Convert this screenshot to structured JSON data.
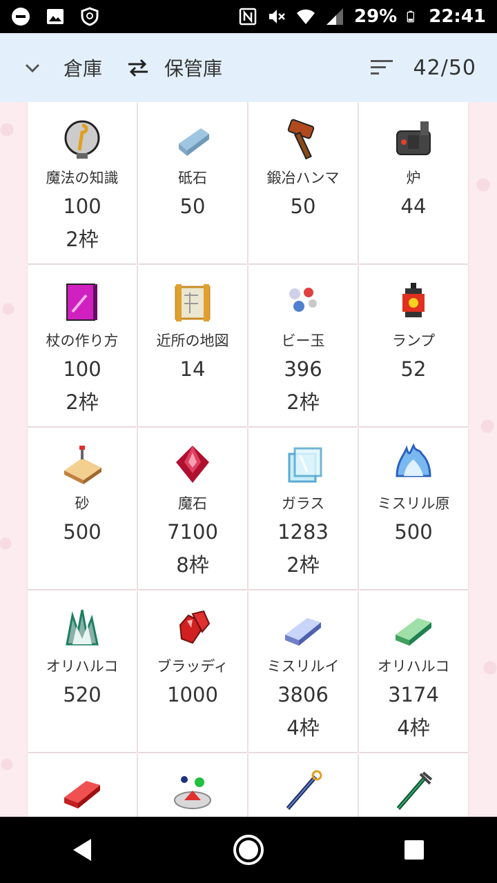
{
  "status_bar": {
    "battery": "29%",
    "time": "22:41",
    "left_icons": [
      "dnd-icon",
      "image-icon",
      "shield-icon"
    ],
    "right_icons": [
      "nfc-icon",
      "mute-icon",
      "wifi-icon",
      "signal-icon",
      "battery-icon"
    ]
  },
  "header": {
    "title": "倉庫",
    "subtitle": "保管庫",
    "count": "42/50"
  },
  "items": [
    {
      "name": "魔法の知識",
      "qty": "100",
      "slots": "2枠",
      "icon": "magic-knowledge-icon"
    },
    {
      "name": "砥石",
      "qty": "50",
      "slots": "",
      "icon": "whetstone-icon"
    },
    {
      "name": "鍛冶ハンマ",
      "qty": "50",
      "slots": "",
      "icon": "hammer-icon"
    },
    {
      "name": "炉",
      "qty": "44",
      "slots": "",
      "icon": "furnace-icon"
    },
    {
      "name": "杖の作り方",
      "qty": "100",
      "slots": "2枠",
      "icon": "book-icon"
    },
    {
      "name": "近所の地図",
      "qty": "14",
      "slots": "",
      "icon": "map-icon"
    },
    {
      "name": "ビー玉",
      "qty": "396",
      "slots": "2枠",
      "icon": "marbles-icon"
    },
    {
      "name": "ランプ",
      "qty": "52",
      "slots": "",
      "icon": "lamp-icon"
    },
    {
      "name": "砂",
      "qty": "500",
      "slots": "",
      "icon": "sand-icon"
    },
    {
      "name": "魔石",
      "qty": "7100",
      "slots": "8枠",
      "icon": "magic-stone-icon"
    },
    {
      "name": "ガラス",
      "qty": "1283",
      "slots": "2枠",
      "icon": "glass-icon"
    },
    {
      "name": "ミスリル原",
      "qty": "500",
      "slots": "",
      "icon": "mithril-ore-icon"
    },
    {
      "name": "オリハルコ",
      "qty": "520",
      "slots": "",
      "icon": "orichalcum-ore-icon"
    },
    {
      "name": "ブラッディ",
      "qty": "1000",
      "slots": "",
      "icon": "bloody-ore-icon"
    },
    {
      "name": "ミスリルイ",
      "qty": "3806",
      "slots": "4枠",
      "icon": "mithril-ingot-icon"
    },
    {
      "name": "オリハルコ",
      "qty": "3174",
      "slots": "4枠",
      "icon": "orichalcum-ingot-icon"
    },
    {
      "name": "",
      "qty": "",
      "slots": "",
      "icon": "red-ingot-icon"
    },
    {
      "name": "",
      "qty": "",
      "slots": "",
      "icon": "potion-plate-icon"
    },
    {
      "name": "",
      "qty": "",
      "slots": "",
      "icon": "blue-staff-icon"
    },
    {
      "name": "",
      "qty": "",
      "slots": "",
      "icon": "green-staff-icon"
    }
  ],
  "colors": {
    "header_bg": "#e3f0fb",
    "content_bg": "#fcecef",
    "status_bg": "#000000"
  }
}
